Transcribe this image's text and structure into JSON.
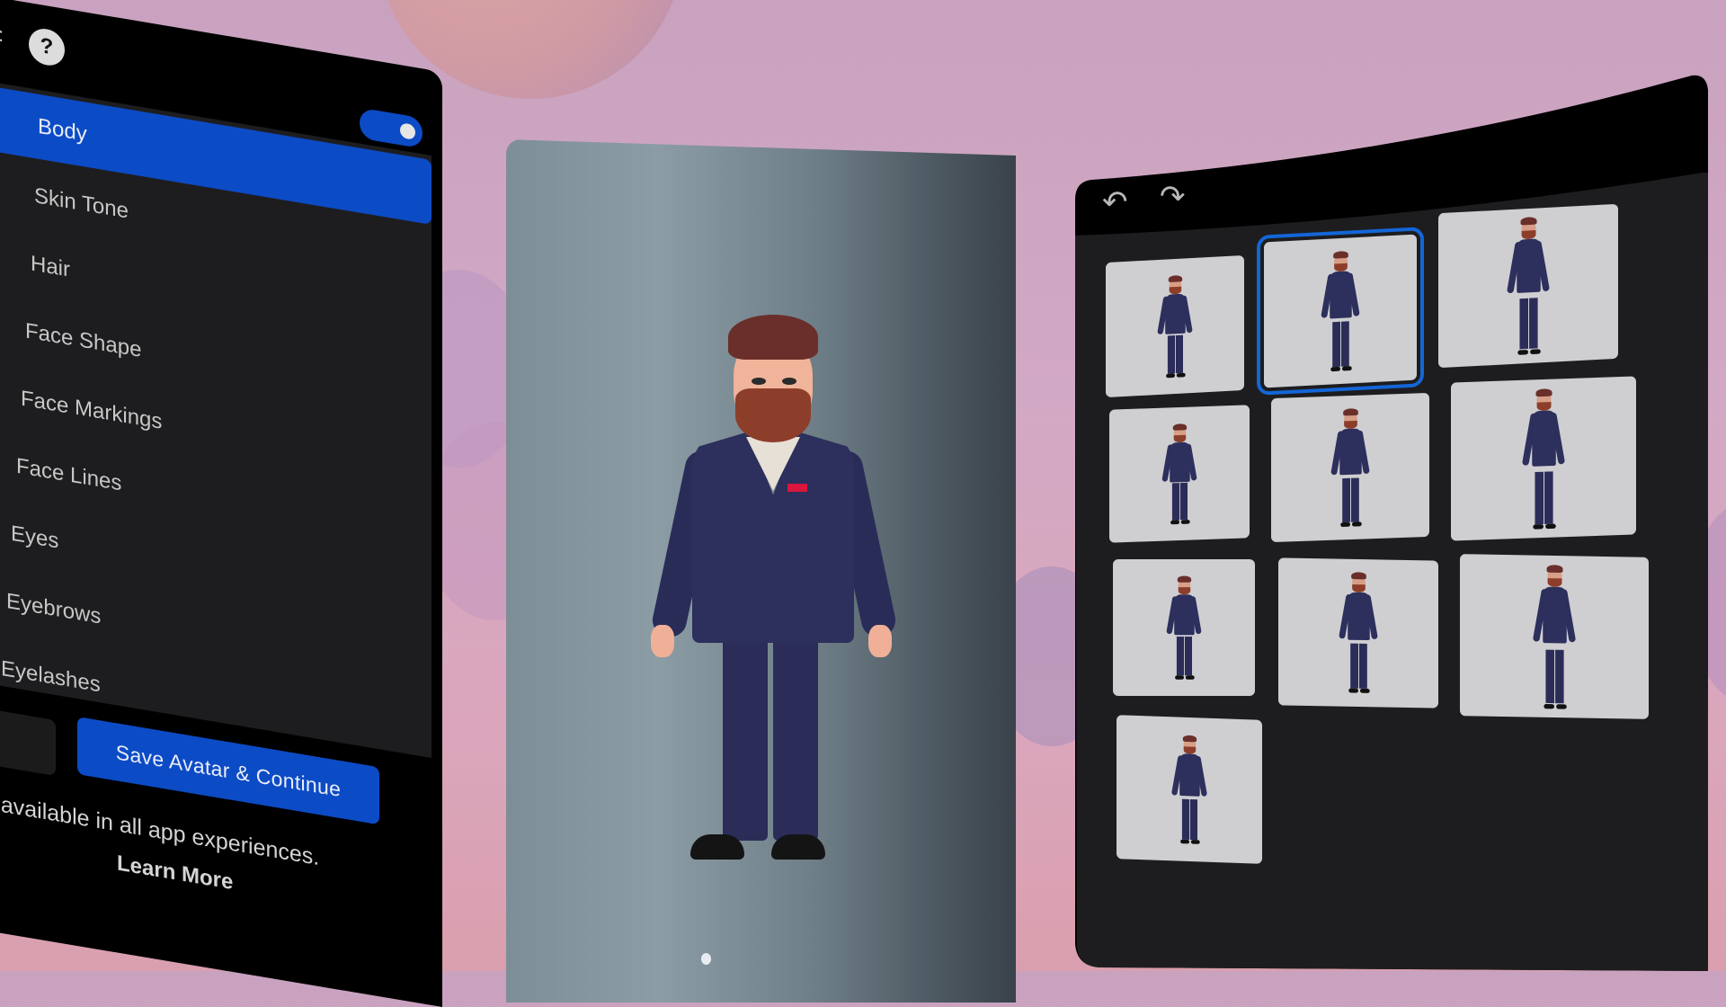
{
  "left_panel": {
    "help_label": "?",
    "toggle": {
      "state": "on"
    },
    "menu_items": [
      {
        "label": "Body",
        "active": true
      },
      {
        "label": "Skin Tone",
        "active": false
      },
      {
        "label": "Hair",
        "active": false
      },
      {
        "label": "Face Shape",
        "active": false
      },
      {
        "label": "Face Markings",
        "active": false
      },
      {
        "label": "Face Lines",
        "active": false
      },
      {
        "label": "Eyes",
        "active": false
      },
      {
        "label": "Eyebrows",
        "active": false
      },
      {
        "label": "Eyelashes",
        "active": false
      }
    ],
    "save_button_label": "Save Avatar & Continue",
    "info_text": "e available in all app experiences.",
    "learn_more_label": "Learn More"
  },
  "center_panel": {
    "preview": "avatar-preview",
    "page_indicator": {
      "current": 1
    }
  },
  "right_panel": {
    "undo_icon": "undo-icon",
    "redo_icon": "redo-icon",
    "undo_glyph": "↶",
    "redo_glyph": "↷",
    "body_options": [
      {
        "id": 1,
        "selected": false
      },
      {
        "id": 2,
        "selected": true
      },
      {
        "id": 3,
        "selected": false
      },
      {
        "id": 4,
        "selected": false
      },
      {
        "id": 5,
        "selected": false
      },
      {
        "id": 6,
        "selected": false
      },
      {
        "id": 7,
        "selected": false
      },
      {
        "id": 8,
        "selected": false
      },
      {
        "id": 9,
        "selected": false
      },
      {
        "id": 10,
        "selected": false
      }
    ]
  },
  "colors": {
    "accent": "#0c4bc6",
    "selection_outline": "#1366d6",
    "panel_bg": "#1d1d1f",
    "panel_header": "#000000",
    "thumbnail_bg": "#cfcfd2"
  }
}
